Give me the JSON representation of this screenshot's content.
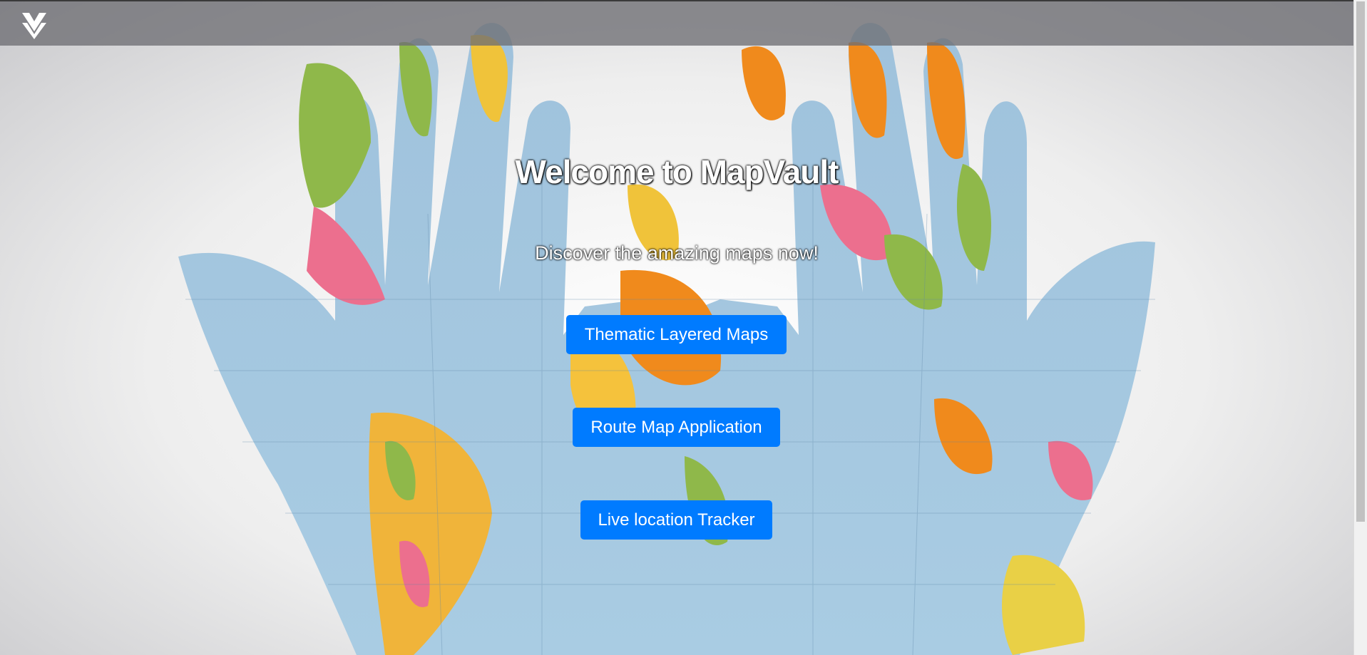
{
  "hero": {
    "title": "Welcome to MapVault",
    "subtitle": "Discover the amazing maps now!"
  },
  "actions": [
    {
      "label": "Thematic Layered Maps"
    },
    {
      "label": "Route Map Application"
    },
    {
      "label": "Live location Tracker"
    }
  ],
  "icons": {
    "logo": "mapvault-logo-icon"
  },
  "colors": {
    "accent": "#007bff",
    "navbar": "#6e6e73",
    "text_on_hero": "#ffffff"
  }
}
